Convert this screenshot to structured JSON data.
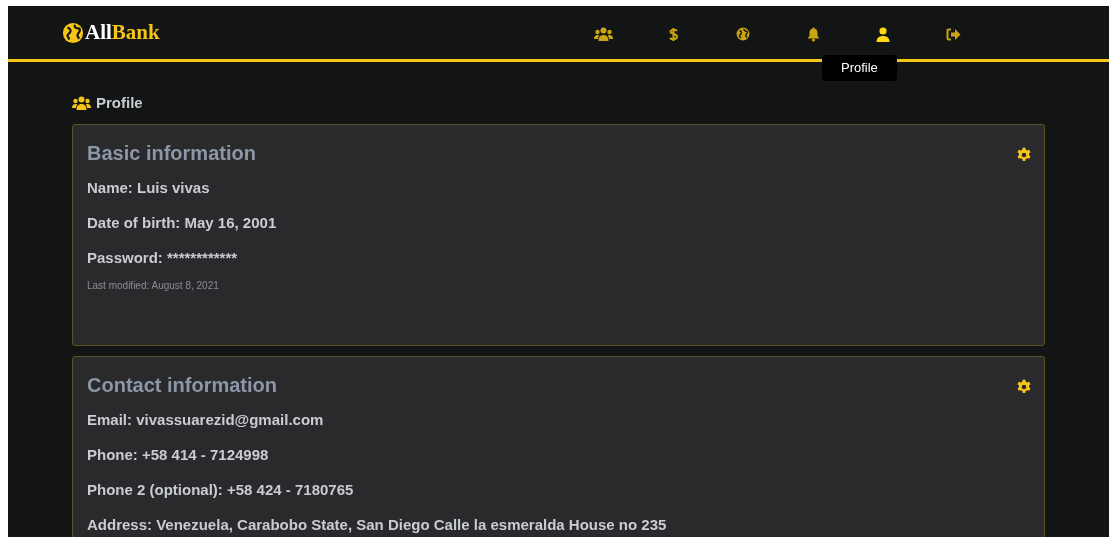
{
  "brand": {
    "first": "All",
    "second": "Bank"
  },
  "nav": [
    {
      "kind": "users",
      "selected": false
    },
    {
      "kind": "dollar",
      "selected": false
    },
    {
      "kind": "globe",
      "selected": false
    },
    {
      "kind": "bell",
      "selected": false
    },
    {
      "kind": "user",
      "selected": true
    },
    {
      "kind": "logout",
      "selected": false
    }
  ],
  "tooltip": "Profile",
  "page_title": "Profile",
  "cards": [
    {
      "title": "Basic information",
      "lines": [
        "Name: Luis vivas",
        "Date of birth: May 16, 2001",
        "Password: ************"
      ],
      "note": "Last modified: August 8, 2021"
    },
    {
      "title": "Contact information",
      "lines": [
        "Email: vivassuarezid@gmail.com",
        "Phone: +58 414 - 7124998",
        "Phone 2 (optional): +58 424 - 7180765",
        "Address: Venezuela, Carabobo State, San Diego Calle la esmeralda House no 235"
      ]
    }
  ]
}
